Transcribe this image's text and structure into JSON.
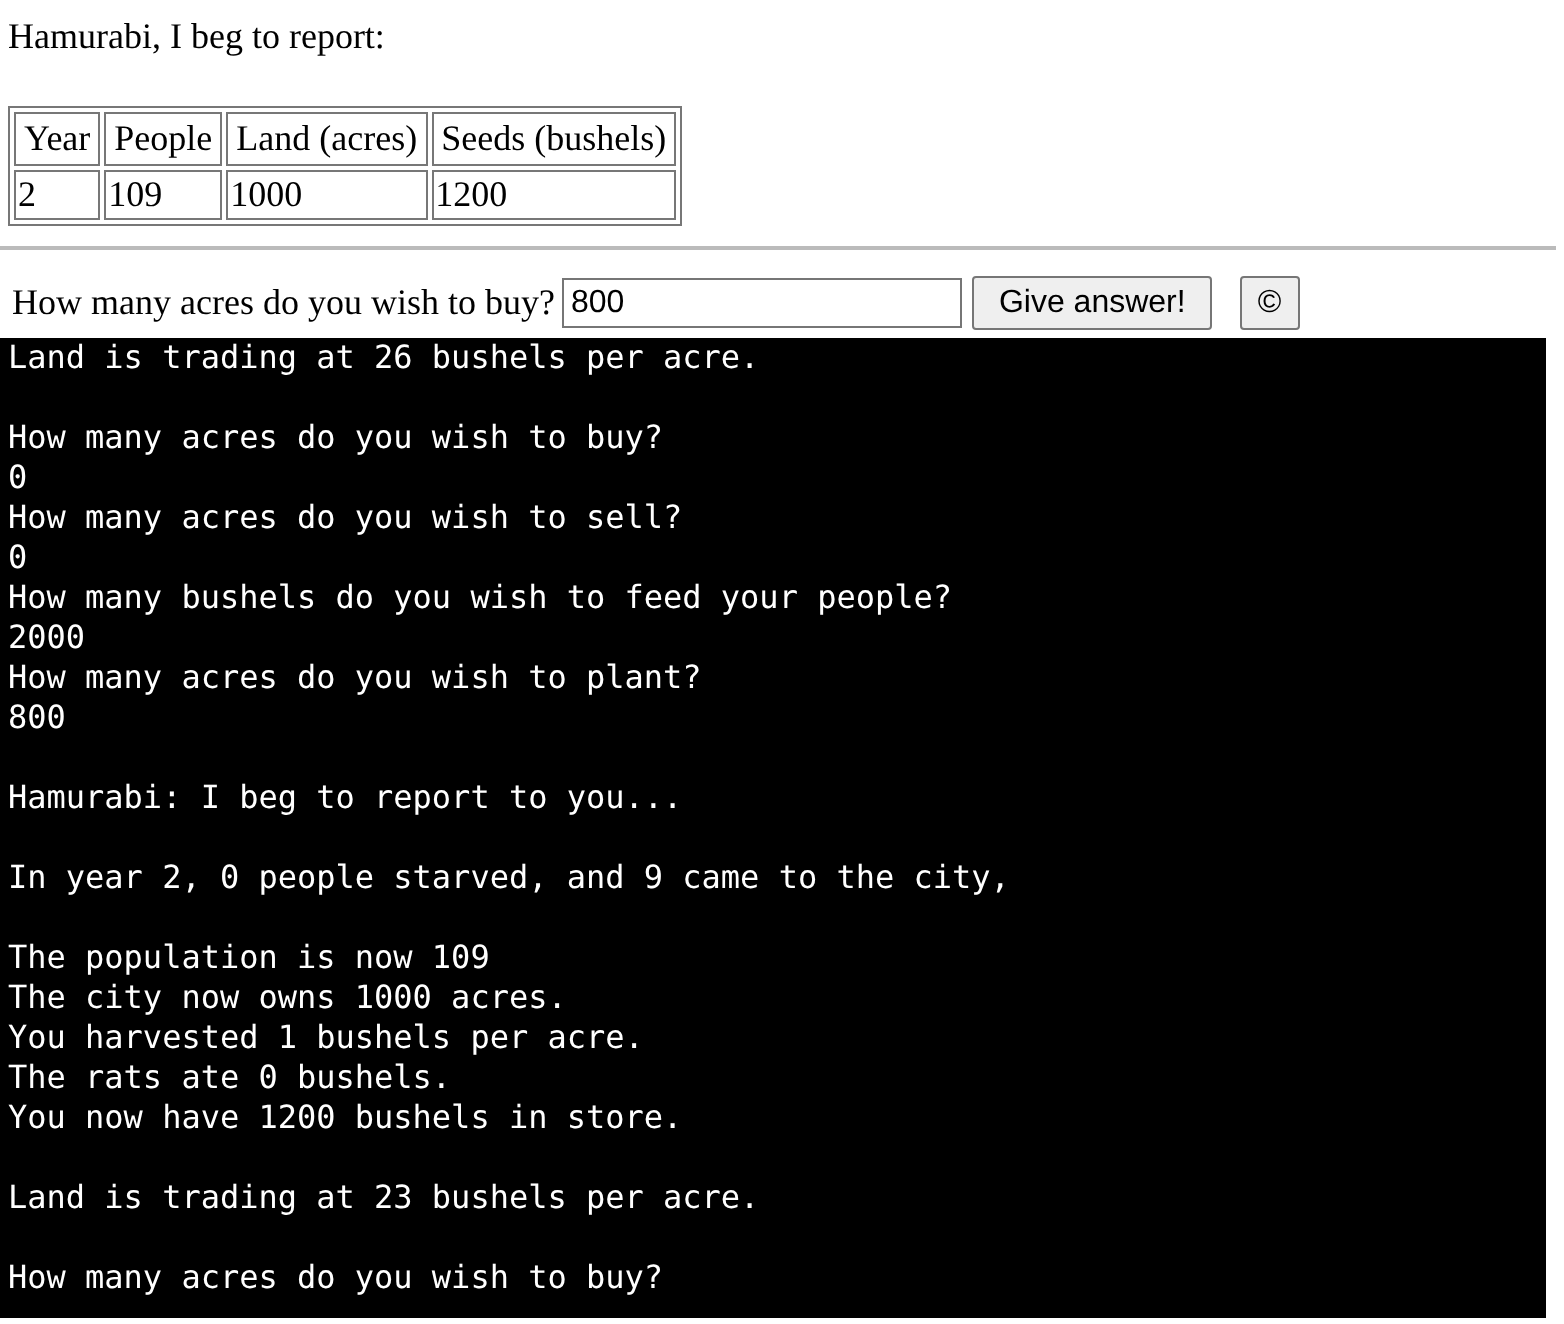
{
  "heading": "Hamurabi, I beg to report:",
  "table": {
    "columns": [
      "Year",
      "People",
      "Land (acres)",
      "Seeds (bushels)"
    ],
    "rows": [
      [
        "2",
        "109",
        "1000",
        "1200"
      ]
    ]
  },
  "form": {
    "label": "How many acres do you wish to buy?",
    "value": "800",
    "buttons": [
      "Give answer!",
      "©"
    ]
  },
  "console": {
    "blocks": [
      [
        "Land is trading at 26 bushels per acre."
      ],
      [
        "How many acres do you wish to buy?",
        "0",
        "How many acres do you wish to sell?",
        "0",
        "How many bushels do you wish to feed your people?",
        "2000",
        "How many acres do you wish to plant?",
        "800"
      ],
      [
        "Hamurabi: I beg to report to you..."
      ],
      [
        "In year 2, 0 people starved, and 9 came to the city,"
      ],
      [
        "The population is now 109",
        "The city now owns 1000 acres.",
        "You harvested 1 bushels per acre.",
        "The rats ate 0 bushels.",
        "You now have 1200 bushels in store."
      ],
      [
        "Land is trading at 23 bushels per acre."
      ],
      [
        "How many acres do you wish to buy?"
      ]
    ]
  }
}
